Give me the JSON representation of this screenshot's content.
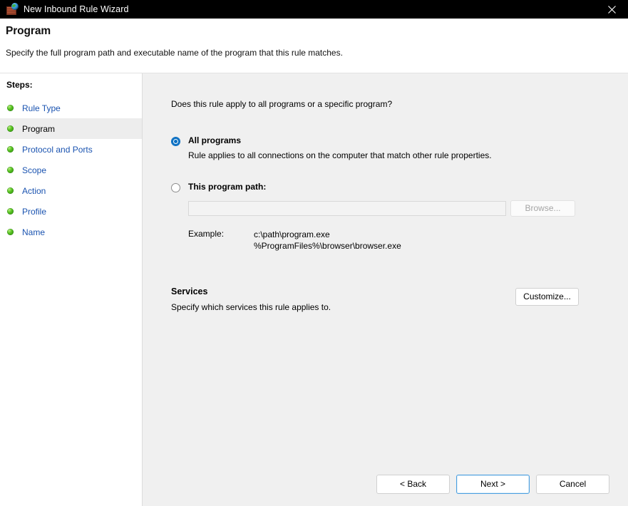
{
  "window": {
    "title": "New Inbound Rule Wizard",
    "app_icon": "firewall-brickwall-globe-icon",
    "close_label": "✕"
  },
  "header": {
    "title": "Program",
    "subtitle": "Specify the full program path and executable name of the program that this rule matches."
  },
  "sidebar": {
    "heading": "Steps:",
    "items": [
      {
        "label": "Rule Type",
        "current": false
      },
      {
        "label": "Program",
        "current": true
      },
      {
        "label": "Protocol and Ports",
        "current": false
      },
      {
        "label": "Scope",
        "current": false
      },
      {
        "label": "Action",
        "current": false
      },
      {
        "label": "Profile",
        "current": false
      },
      {
        "label": "Name",
        "current": false
      }
    ]
  },
  "main": {
    "question": "Does this rule apply to all programs or a specific program?",
    "options": [
      {
        "label": "All programs",
        "description": "Rule applies to all connections on the computer that match other rule properties.",
        "selected": true
      },
      {
        "label": "This program path:",
        "selected": false
      }
    ],
    "program_path": {
      "value": "",
      "placeholder": "",
      "browse_label": "Browse...",
      "browse_enabled": false,
      "input_enabled": false
    },
    "example": {
      "label": "Example:",
      "values": [
        "c:\\path\\program.exe",
        "%ProgramFiles%\\browser\\browser.exe"
      ]
    },
    "services": {
      "title": "Services",
      "description": "Specify which services this rule applies to.",
      "customize_label": "Customize..."
    }
  },
  "footer": {
    "back_label": "< Back",
    "next_label": "Next >",
    "cancel_label": "Cancel"
  },
  "colors": {
    "titlebar_bg": "#000000",
    "panel_bg": "#f0f0f0",
    "sidebar_bg": "#ffffff",
    "link": "#1a53b0",
    "accent": "#0a6fc2",
    "default_button_border": "#4a9fe0",
    "step_bullet": "#56c021"
  }
}
